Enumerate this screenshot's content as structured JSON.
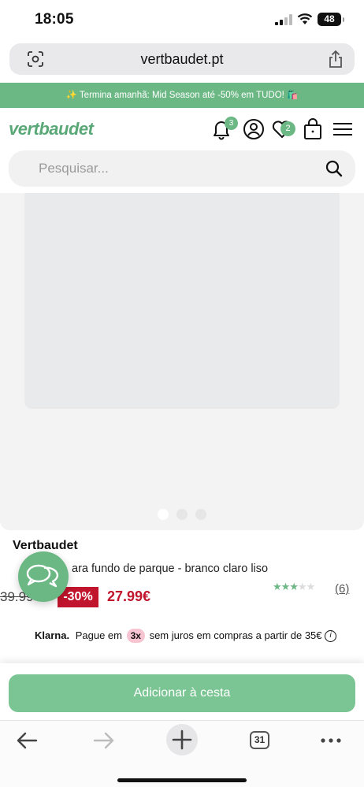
{
  "status_bar": {
    "time": "18:05",
    "battery": "48"
  },
  "browser": {
    "url": "vertbaudet.pt",
    "tabs_count": "31"
  },
  "promo": {
    "text": "✨ Termina amanhã: Mid Season até -50% em TUDO! 🛍️"
  },
  "header": {
    "logo": "vertbaudet",
    "notifications_count": "3",
    "wishlist_count": "2",
    "search_placeholder": "Pesquisar..."
  },
  "gallery": {
    "slides": 3,
    "active_slide": 1
  },
  "product": {
    "brand": "Vertbaudet",
    "title_visible": "ara fundo de parque - branco claro liso",
    "old_price": "39.99€",
    "discount": "-30%",
    "price": "27.99€",
    "rating": 3,
    "rating_max": 5,
    "review_count": "(6)"
  },
  "klarna": {
    "logo": "Klarna.",
    "text_before": "Pague em",
    "installments": "3x",
    "text_after": "sem juros em compras a partir de 35€"
  },
  "cart": {
    "add_label": "Adicionar à cesta"
  },
  "colors": {
    "brand_green": "#6cb885",
    "sale_red": "#c0152c"
  }
}
